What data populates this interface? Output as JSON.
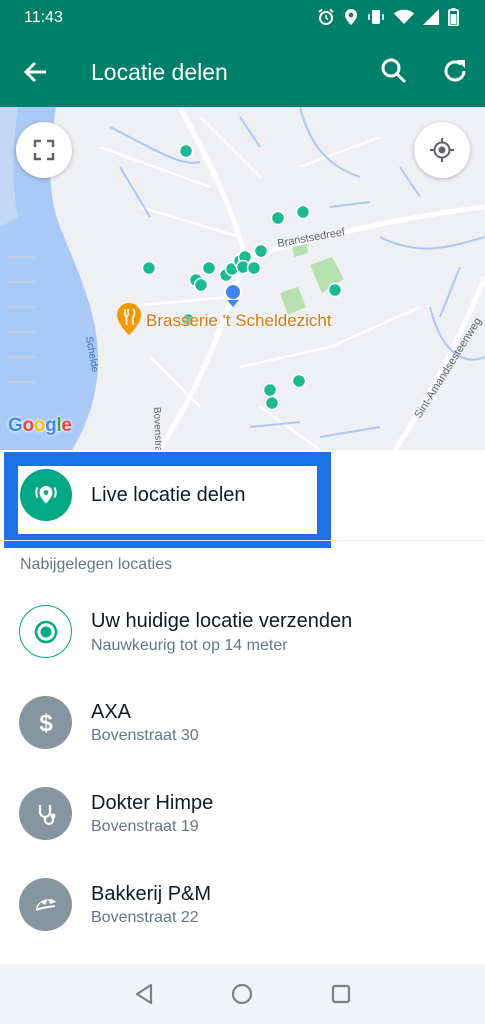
{
  "status_bar": {
    "time": "11:43",
    "icons": [
      "alarm-icon",
      "location-icon",
      "vibrate-icon",
      "wifi-icon",
      "signal-icon",
      "battery-icon"
    ]
  },
  "app_bar": {
    "title": "Locatie delen",
    "icons": [
      "back-arrow-icon",
      "search-icon",
      "refresh-icon"
    ],
    "color": "#008069"
  },
  "map": {
    "place_label": "Brasserie 't Scheldezicht",
    "street_labels": [
      "Branstsedreef",
      "Schelde",
      "Bovenstraat",
      "Sint-Amandsesteenweg"
    ],
    "attribution": "Google",
    "marker_color": "#1db992",
    "water_color": "#a9c9f7"
  },
  "live": {
    "label": "Live locatie delen",
    "accent": "#00a884",
    "highlight_color": "#1a73e8"
  },
  "section_header": "Nabijgelegen locaties",
  "locations": [
    {
      "title": "Uw huidige locatie verzenden",
      "subtitle": "Nauwkeurig tot op 14 meter",
      "icon": "current-location-icon"
    },
    {
      "title": "AXA",
      "subtitle": "Bovenstraat 30",
      "icon": "dollar-icon"
    },
    {
      "title": "Dokter Himpe",
      "subtitle": "Bovenstraat 19",
      "icon": "stethoscope-icon"
    },
    {
      "title": "Bakkerij P&M",
      "subtitle": "Bovenstraat 22",
      "icon": "croissant-icon"
    }
  ],
  "nav_bar": {
    "icons": [
      "back-triangle-icon",
      "home-circle-icon",
      "recents-square-icon"
    ]
  }
}
